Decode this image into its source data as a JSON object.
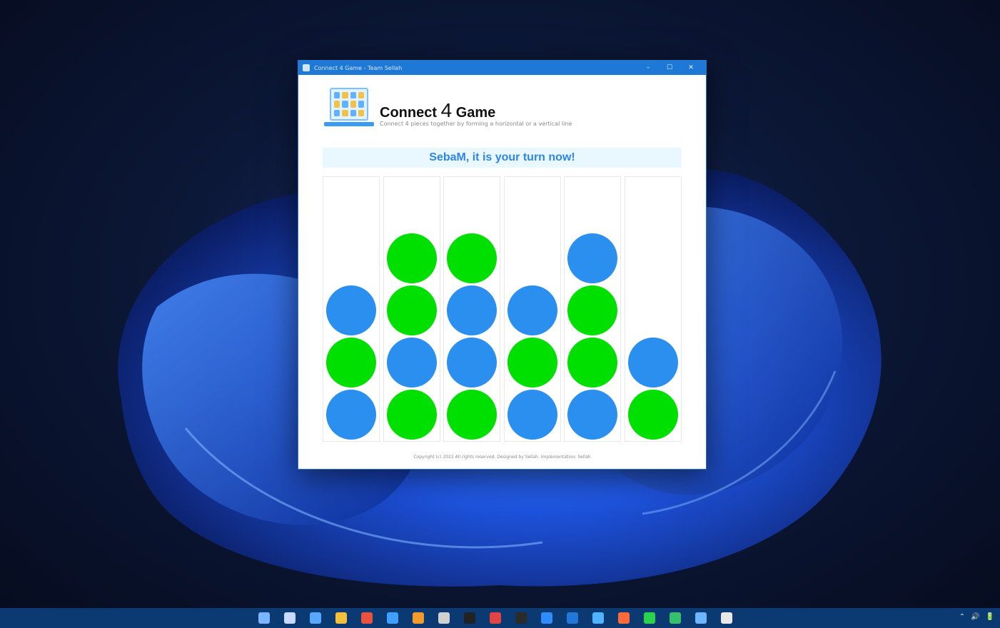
{
  "window": {
    "title": "Connect 4 Game - Team Sellah",
    "min_glyph": "–",
    "max_glyph": "☐",
    "close_glyph": "✕"
  },
  "app": {
    "title_pre": "Connect ",
    "title_num": "4",
    "title_post": " Game",
    "subtitle": "Connect 4 pieces together by forming a horizontal or a vertical line",
    "turn_message": "SebaM, it is your turn now!",
    "footer": "Copyright (c) 2022 All rights reserved. Designed by Sellah. Implementation: Sellah"
  },
  "colors": {
    "player_blue": "#2b8ff0",
    "player_green": "#00e000",
    "titlebar": "#1e78d6",
    "taskbar": "#0b3a73"
  },
  "board": {
    "columns": 6,
    "rows": 5,
    "cells": [
      [
        "empty",
        "empty",
        "empty",
        "empty",
        "empty",
        "empty"
      ],
      [
        "empty",
        "green",
        "green",
        "empty",
        "blue",
        "empty"
      ],
      [
        "blue",
        "green",
        "blue",
        "blue",
        "green",
        "empty"
      ],
      [
        "green",
        "blue",
        "blue",
        "green",
        "green",
        "blue"
      ],
      [
        "blue",
        "green",
        "green",
        "blue",
        "blue",
        "green"
      ]
    ]
  },
  "taskbar": {
    "icons": [
      "start-icon",
      "search-icon",
      "task-view-icon",
      "file-explorer-icon",
      "chrome-icon",
      "store-icon",
      "app-icon",
      "app-icon",
      "app-icon",
      "terminal-icon",
      "app-icon",
      "vscode-icon",
      "app-icon",
      "app-icon",
      "app-icon",
      "app-icon",
      "app-icon",
      "app-icon",
      "app-icon"
    ],
    "icon_colors": [
      "#7ab6ff",
      "#c8d9ff",
      "#58a8ff",
      "#f3c03d",
      "#e7533f",
      "#3fa0ff",
      "#f39a2c",
      "#d0d0d0",
      "#222222",
      "#e04545",
      "#2b2b2b",
      "#2f8cff",
      "#2377d8",
      "#4fb3ff",
      "#ff6a3d",
      "#2bd34d",
      "#37c06b",
      "#6db6ff",
      "#e8e8e8"
    ],
    "tray": [
      "⌃",
      "🔊",
      "🔋"
    ]
  }
}
